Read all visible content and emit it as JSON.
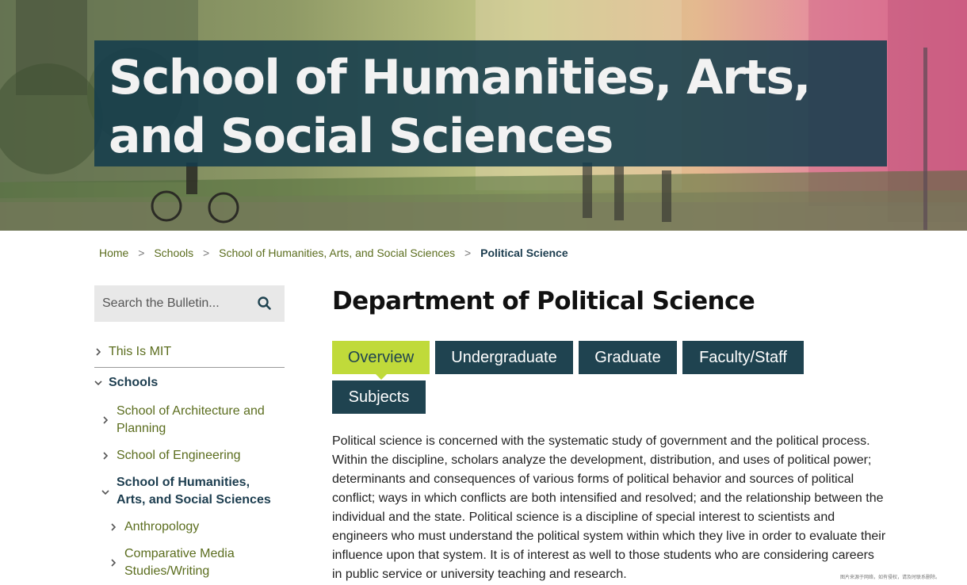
{
  "hero": {
    "title": "School of Humanities, Arts, and Social Sciences"
  },
  "breadcrumb": {
    "items": [
      "Home",
      "Schools",
      "School of Humanities, Arts, and Social Sciences"
    ],
    "separator": ">",
    "current": "Political Science"
  },
  "search": {
    "placeholder": "Search the Bulletin...",
    "icon": "search-icon"
  },
  "sidebar": {
    "items": [
      {
        "label": "This Is MIT",
        "icon": "chevron-right-icon"
      },
      {
        "label": "Schools",
        "icon": "chevron-down-icon"
      },
      {
        "label": "School of Architecture and Planning",
        "icon": "chevron-right-icon"
      },
      {
        "label": "School of Engineering",
        "icon": "chevron-right-icon"
      },
      {
        "label": "School of Humanities, Arts, and Social Sciences",
        "icon": "chevron-down-icon"
      },
      {
        "label": "Anthropology",
        "icon": "chevron-right-icon"
      },
      {
        "label": "Comparative Media Studies/Writing",
        "icon": "chevron-right-icon"
      }
    ]
  },
  "main": {
    "title": "Department of Political Science",
    "tabs": [
      {
        "label": "Overview",
        "active": true
      },
      {
        "label": "Undergraduate",
        "active": false
      },
      {
        "label": "Graduate",
        "active": false
      },
      {
        "label": "Faculty/Staff",
        "active": false
      },
      {
        "label": "Subjects",
        "active": false
      }
    ],
    "body": "Political science is concerned with the systematic study of government and the political process. Within the discipline, scholars analyze the development, distribution, and uses of political power; determinants and consequences of various forms of political behavior and sources of political conflict; ways in which conflicts are both intensified and resolved; and the relationship between the individual and the state. Political science is a discipline of special interest to scientists and engineers who must understand the political system within which they live in order to evaluate their influence upon that system. It is of interest as well to those students who are considering careers in public service or university teaching and research."
  },
  "watermark": "图片来源于网络，如有侵权，请及时联系删除。",
  "colors": {
    "title_box": "#153c4c",
    "tab_dark": "#1f4350",
    "tab_active": "#c0da3a",
    "link_green": "#5b6d1e",
    "current_dark": "#1c3d4f"
  }
}
